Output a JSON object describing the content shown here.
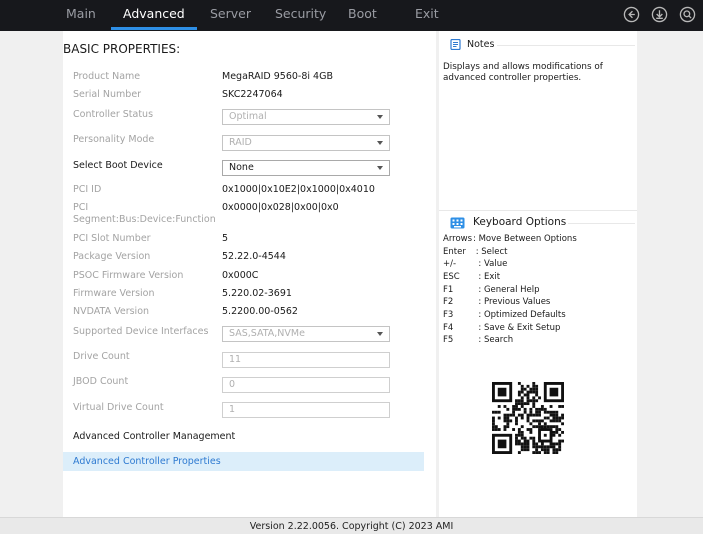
{
  "tabs": [
    {
      "label": "Main",
      "active": false
    },
    {
      "label": "Advanced",
      "active": true
    },
    {
      "label": "Server",
      "active": false
    },
    {
      "label": "Security",
      "active": false
    },
    {
      "label": "Boot",
      "active": false
    },
    {
      "label": "Exit",
      "active": false
    }
  ],
  "top_icons": [
    "back-icon",
    "download-icon",
    "search-icon"
  ],
  "section_title": "BASIC PROPERTIES:",
  "fields": {
    "product_name": {
      "label": "Product Name",
      "value": "MegaRAID 9560-8i 4GB"
    },
    "serial_number": {
      "label": "Serial Number",
      "value": "SKC2247064"
    },
    "controller_status": {
      "label": "Controller Status",
      "value": "Optimal"
    },
    "personality_mode": {
      "label": "Personality Mode",
      "value": "RAID"
    },
    "select_boot_device": {
      "label": "Select Boot Device",
      "value": "None"
    },
    "pci_id": {
      "label": "PCI ID",
      "value": "0x1000|0x10E2|0x1000|0x4010"
    },
    "pci_segment": {
      "label1": "PCI",
      "label2": "Segment:Bus:Device:Function",
      "value": "0x0000|0x028|0x00|0x0"
    },
    "pci_slot_number": {
      "label": "PCI Slot Number",
      "value": "5"
    },
    "package_version": {
      "label": "Package Version",
      "value": "52.22.0-4544"
    },
    "psoc_firmware_version": {
      "label": "PSOC Firmware Version",
      "value": "0x000C"
    },
    "firmware_version": {
      "label": "Firmware Version",
      "value": "5.220.02-3691"
    },
    "nvdata_version": {
      "label": "NVDATA Version",
      "value": "5.2200.00-0562"
    },
    "supported_interfaces": {
      "label": "Supported Device Interfaces",
      "value": "SAS,SATA,NVMe"
    },
    "drive_count": {
      "label": "Drive Count",
      "value": "11"
    },
    "jbod_count": {
      "label": "JBOD Count",
      "value": "0"
    },
    "virtual_drive_count": {
      "label": "Virtual Drive Count",
      "value": "1"
    }
  },
  "links": {
    "advanced_management": "Advanced Controller Management",
    "advanced_properties": "Advanced Controller Properties"
  },
  "notes": {
    "title": "Notes",
    "text_line1": "Displays and allows modifications of",
    "text_line2": "advanced controller properties."
  },
  "keyboard": {
    "title": "Keyboard Options",
    "items": [
      {
        "key": "Arrows",
        "desc": ": Move Between Options"
      },
      {
        "key": "Enter",
        "desc": " : Select"
      },
      {
        "key": "+/-",
        "desc": "  : Value"
      },
      {
        "key": "ESC",
        "desc": "  : Exit"
      },
      {
        "key": "F1",
        "desc": "  : General Help"
      },
      {
        "key": "F2",
        "desc": "  : Previous Values"
      },
      {
        "key": "F3",
        "desc": "  : Optimized Defaults"
      },
      {
        "key": "F4",
        "desc": "  : Save & Exit Setup"
      },
      {
        "key": "F5",
        "desc": "  : Search"
      }
    ]
  },
  "footer": "Version 2.22.0056. Copyright (C) 2023 AMI",
  "colors": {
    "accent": "#2e8fe6",
    "topbar": "#17181c",
    "selected_bg": "#dceefa",
    "link_blue": "#2e7ad1"
  }
}
